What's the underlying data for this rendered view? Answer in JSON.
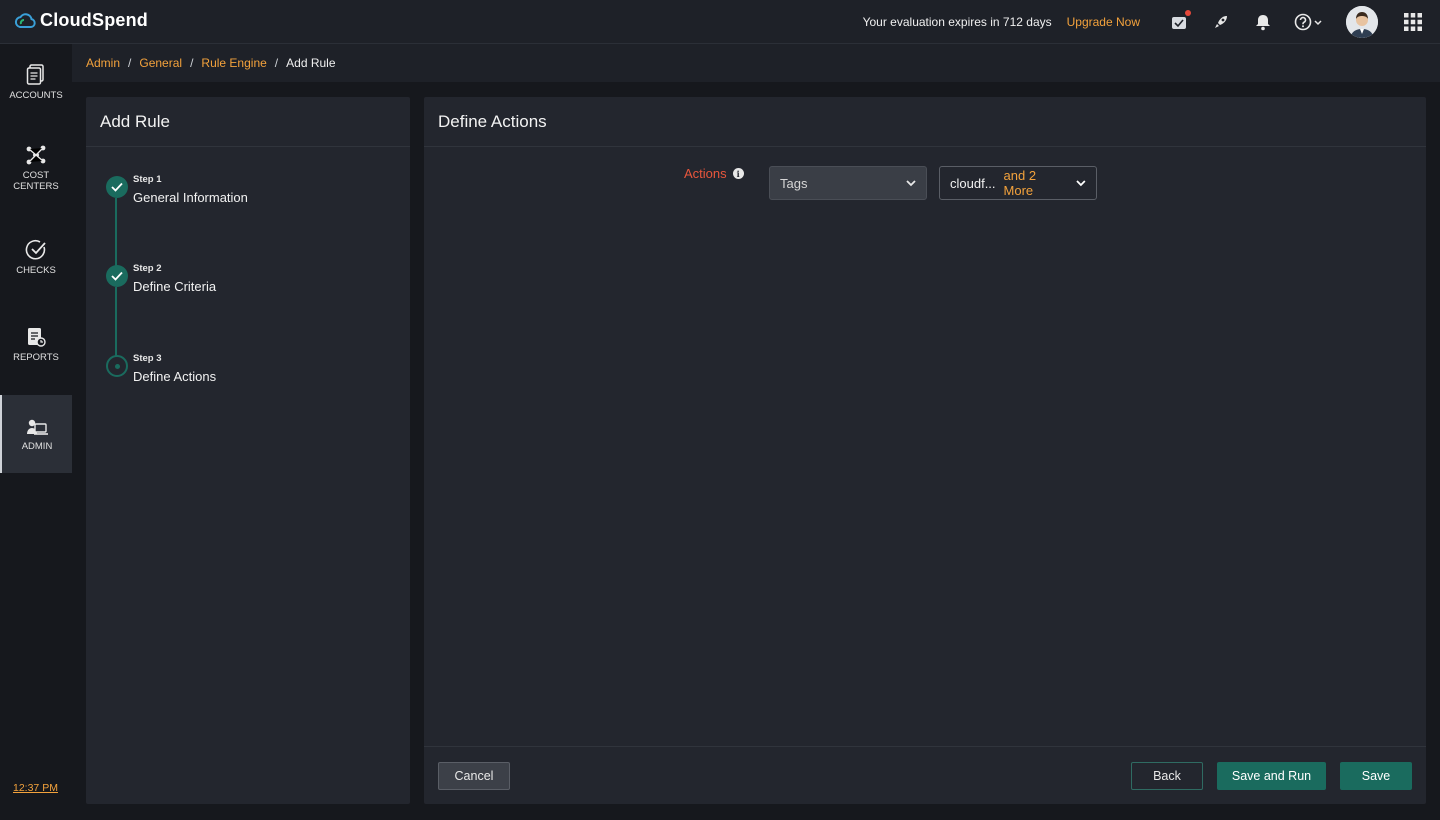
{
  "app": {
    "name": "CloudSpend"
  },
  "topbar": {
    "evaluation_text": "Your evaluation expires in 712 days",
    "upgrade_label": "Upgrade Now",
    "icons": [
      "whats-new-icon",
      "rocket-icon",
      "bell-icon",
      "help-icon",
      "avatar",
      "apps-grid-icon"
    ]
  },
  "nav": {
    "items": [
      {
        "label": "ACCOUNTS",
        "icon": "accounts-icon"
      },
      {
        "label": "COST",
        "label2": "CENTERS",
        "icon": "cost-centers-icon"
      },
      {
        "label": "CHECKS",
        "icon": "checks-icon"
      },
      {
        "label": "REPORTS",
        "icon": "reports-icon"
      },
      {
        "label": "ADMIN",
        "icon": "admin-icon",
        "active": true
      }
    ],
    "time": "12:37 PM"
  },
  "breadcrumb": {
    "items": [
      "Admin",
      "General",
      "Rule Engine"
    ],
    "current": "Add Rule"
  },
  "wizard": {
    "title": "Add Rule",
    "steps": [
      {
        "num": "Step 1",
        "title": "General Information",
        "state": "done"
      },
      {
        "num": "Step 2",
        "title": "Define Criteria",
        "state": "done"
      },
      {
        "num": "Step 3",
        "title": "Define Actions",
        "state": "current"
      }
    ]
  },
  "main": {
    "title": "Define Actions",
    "actions_label": "Actions",
    "action_type": "Tags",
    "tag_value": "cloudf...",
    "tag_more": "and 2 More"
  },
  "footer": {
    "cancel": "Cancel",
    "back": "Back",
    "save_and_run": "Save and Run",
    "save": "Save"
  },
  "colors": {
    "accent": "#1a6b5e",
    "link": "#f3a23c",
    "required_label": "#e8563c"
  }
}
